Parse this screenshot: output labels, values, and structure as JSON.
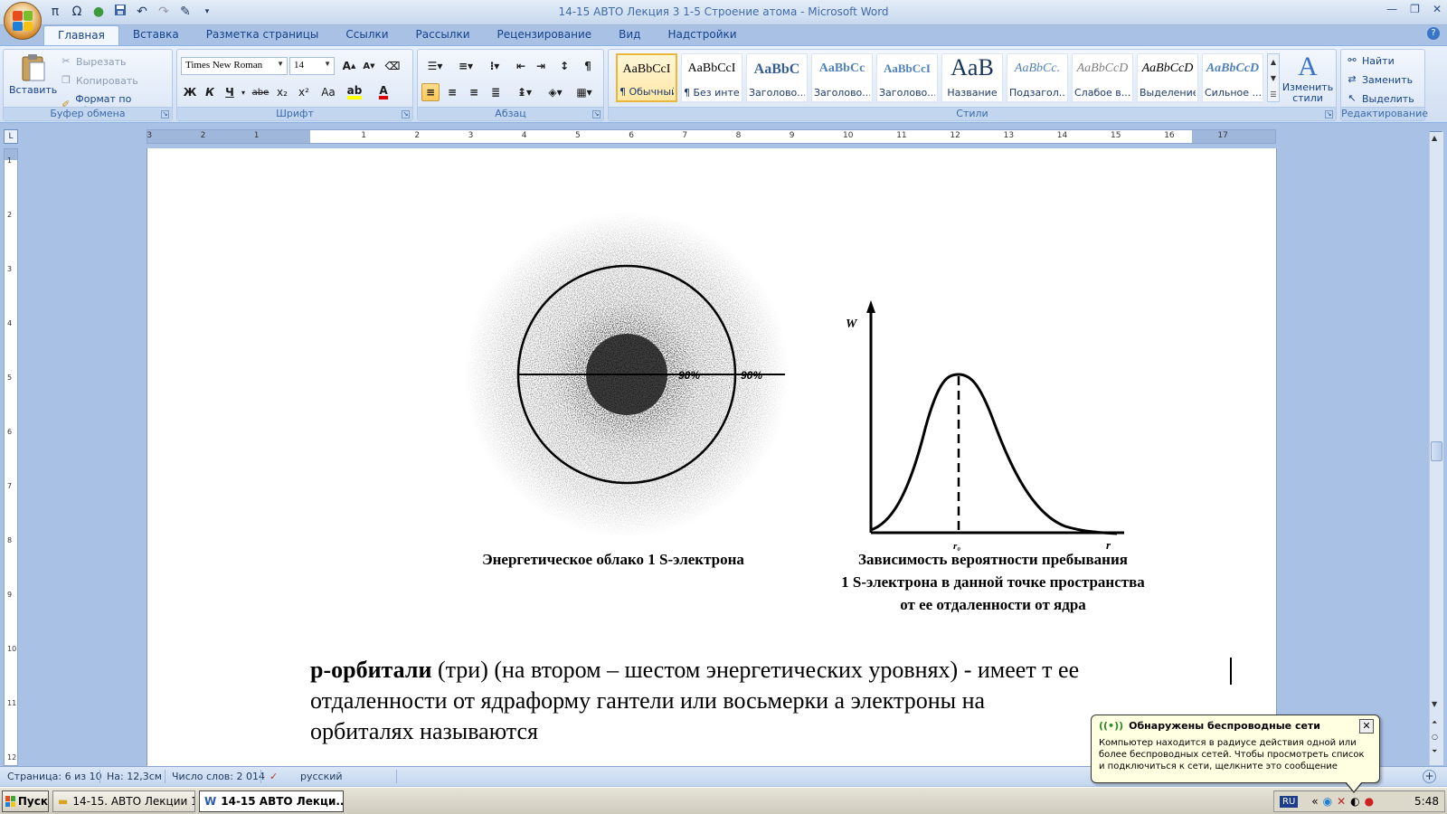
{
  "window": {
    "title": "14-15  АВТО Лекция 3  1-5  Строение  атома - Microsoft Word"
  },
  "quick_access": [
    "π",
    "Ω"
  ],
  "tabs": [
    {
      "label": "Главная",
      "active": true
    },
    {
      "label": "Вставка"
    },
    {
      "label": "Разметка страницы"
    },
    {
      "label": "Ссылки"
    },
    {
      "label": "Рассылки"
    },
    {
      "label": "Рецензирование"
    },
    {
      "label": "Вид"
    },
    {
      "label": "Надстройки"
    }
  ],
  "ribbon": {
    "clipboard": {
      "label": "Буфер обмена",
      "paste": "Вставить",
      "cut": "Вырезать",
      "copy": "Копировать",
      "format_painter": "Формат по образцу"
    },
    "font": {
      "label": "Шрифт",
      "family": "Times New Roman",
      "size": "14",
      "bold": "Ж",
      "italic": "К",
      "underline": "Ч",
      "strike": "abe",
      "subscript": "x₂",
      "superscript": "x²",
      "case": "Aa"
    },
    "paragraph": {
      "label": "Абзац"
    },
    "styles": {
      "label": "Стили",
      "items": [
        {
          "sample": "AaBbCcI",
          "name": "¶ Обычный",
          "selected": true
        },
        {
          "sample": "AaBbCcI",
          "name": "¶ Без инте..."
        },
        {
          "sample": "AaBbC",
          "name": "Заголово..."
        },
        {
          "sample": "AaBbCc",
          "name": "Заголово..."
        },
        {
          "sample": "AaBbCcI",
          "name": "Заголово..."
        },
        {
          "sample": "AaB",
          "name": "Название"
        },
        {
          "sample": "AaBbCc.",
          "name": "Подзагол..."
        },
        {
          "sample": "AaBbCcD",
          "name": "Слабое в..."
        },
        {
          "sample": "AaBbCcD",
          "name": "Выделение"
        },
        {
          "sample": "AaBbCcD",
          "name": "Сильное ..."
        }
      ],
      "change_styles": "Изменить стили"
    },
    "editing": {
      "label": "Редактирование",
      "find": "Найти",
      "replace": "Заменить",
      "select": "Выделить"
    }
  },
  "ruler": {
    "h_numbers": [
      "3",
      "2",
      "1",
      "1",
      "2",
      "3",
      "4",
      "5",
      "6",
      "7",
      "8",
      "9",
      "10",
      "11",
      "12",
      "13",
      "14",
      "15",
      "16",
      "17"
    ],
    "v_numbers": [
      "1",
      "2",
      "3",
      "4",
      "5",
      "6",
      "7",
      "8",
      "9",
      "10",
      "11",
      "12"
    ]
  },
  "document": {
    "figure_left": {
      "labels": [
        "90%",
        "90%"
      ]
    },
    "figure_right": {
      "y_axis": "W",
      "x_axis": "r",
      "peak_label": "r₀"
    },
    "caption_left": "Энергетическое облако 1 S-электрона",
    "caption_right_lines": [
      "Зависимость вероятности пребывания",
      "1 S-электрона в данной точке пространства",
      "от ее отдаленности от ядра"
    ],
    "body_bold": "р-орбитали",
    "body_rest_1": " (три) (на втором – шестом энергетических уровнях) -   имеет т ее",
    "body_line_2": "отдаленности от ядраформу гантели или восьмерки  а электроны на",
    "body_line_3": "орбиталях  называются"
  },
  "status": {
    "page": "Страница: 6 из 10",
    "position": "На: 12,3см",
    "words": "Число слов: 2 014",
    "language": "русский"
  },
  "taskbar": {
    "start": "Пуск",
    "items": [
      {
        "label": "14-15. АВТО  Лекции 1...",
        "active": false
      },
      {
        "label": "14-15   АВТО  Лекци...",
        "active": true
      }
    ],
    "lang": "RU",
    "chevron": "«",
    "time": "5:48"
  },
  "balloon": {
    "title": "Обнаружены беспроводные сети",
    "text": "Компьютер находится в радиусе действия одной или более беспроводных сетей. Чтобы просмотреть список и подключиться к сети, щелкните это сообщение"
  }
}
